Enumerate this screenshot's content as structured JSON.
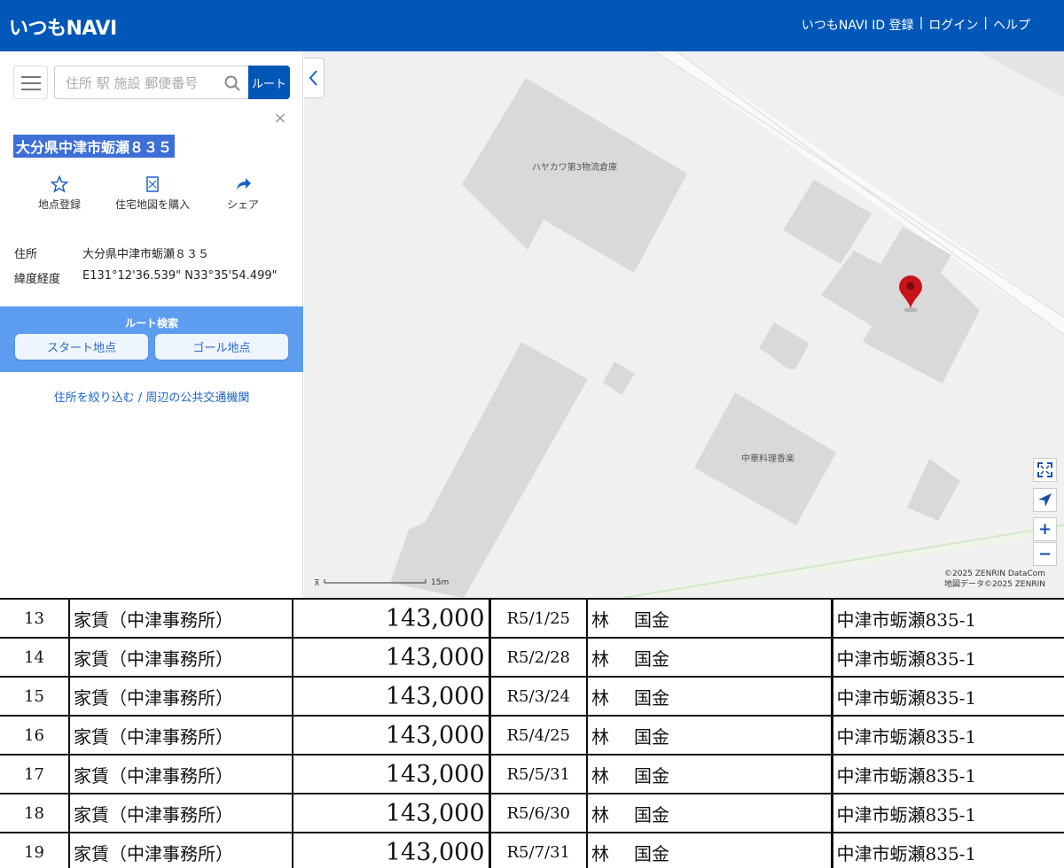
{
  "header": {
    "logo": "いつもNAVI",
    "nav": [
      "いつもNAVI ID 登録",
      "ログイン",
      "ヘルプ"
    ],
    "separator": "|"
  },
  "sidebar": {
    "search_placeholder": "住所 駅 施設 郵便番号",
    "route_button": "ルート",
    "title": "大分県中津市蛎瀬８３５",
    "actions": [
      {
        "label": "地点登録",
        "icon": "star-icon"
      },
      {
        "label": "住宅地図を購入",
        "icon": "map-doc-icon"
      },
      {
        "label": "シェア",
        "icon": "share-icon"
      }
    ],
    "info": [
      {
        "key": "住所",
        "value": "大分県中津市蛎瀬８３５"
      },
      {
        "key": "緯度経度",
        "value": "E131°12'36.539\" N33°35'54.499\""
      }
    ],
    "route_search": {
      "title": "ルート検索",
      "start": "スタート地点",
      "goal": "ゴール地点"
    },
    "links": "住所を絞り込む / 周辺の公共交通機関"
  },
  "map": {
    "labels": [
      "ハヤカワ第3物流倉庫",
      "中華料理香楽"
    ],
    "scale": "15m",
    "copyright": [
      "©2025 ZENRIN DataCom",
      "地図データ©2025 ZENRIN"
    ],
    "colors": {
      "pin": "#c8131b",
      "building": "#d9d9d9",
      "background": "#f0f0f0"
    }
  },
  "table": {
    "rows": [
      {
        "no": "13",
        "desc": "家賃（中津事務所）",
        "amount": "143,000",
        "date": "R5/1/25",
        "payee_surname": "林",
        "payee_given": "国金",
        "location": "中津市蛎瀬835-1"
      },
      {
        "no": "14",
        "desc": "家賃（中津事務所）",
        "amount": "143,000",
        "date": "R5/2/28",
        "payee_surname": "林",
        "payee_given": "国金",
        "location": "中津市蛎瀬835-1"
      },
      {
        "no": "15",
        "desc": "家賃（中津事務所）",
        "amount": "143,000",
        "date": "R5/3/24",
        "payee_surname": "林",
        "payee_given": "国金",
        "location": "中津市蛎瀬835-1"
      },
      {
        "no": "16",
        "desc": "家賃（中津事務所）",
        "amount": "143,000",
        "date": "R5/4/25",
        "payee_surname": "林",
        "payee_given": "国金",
        "location": "中津市蛎瀬835-1"
      },
      {
        "no": "17",
        "desc": "家賃（中津事務所）",
        "amount": "143,000",
        "date": "R5/5/31",
        "payee_surname": "林",
        "payee_given": "国金",
        "location": "中津市蛎瀬835-1"
      },
      {
        "no": "18",
        "desc": "家賃（中津事務所）",
        "amount": "143,000",
        "date": "R5/6/30",
        "payee_surname": "林",
        "payee_given": "国金",
        "location": "中津市蛎瀬835-1"
      },
      {
        "no": "19",
        "desc": "家賃（中津事務所）",
        "amount": "143,000",
        "date": "R5/7/31",
        "payee_surname": "林",
        "payee_given": "国金",
        "location": "中津市蛎瀬835-1"
      }
    ]
  }
}
